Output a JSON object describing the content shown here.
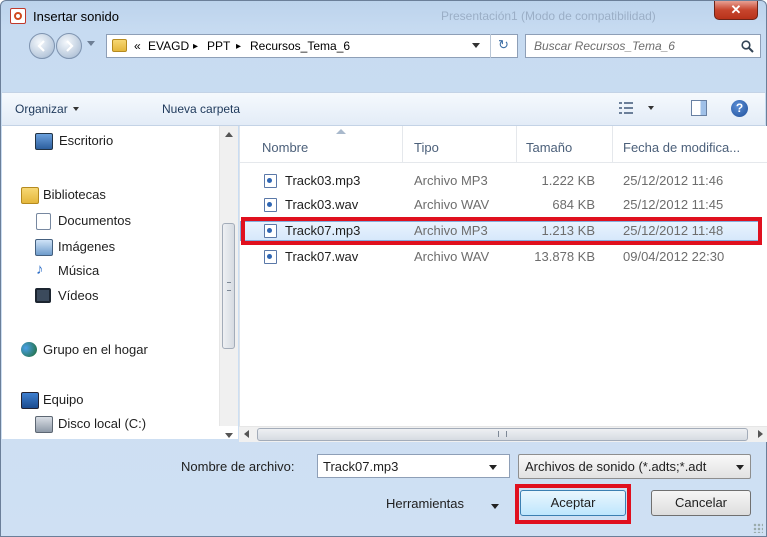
{
  "window": {
    "title": "Insertar sonido",
    "background_title": "Presentación1 (Modo de compatibilidad)"
  },
  "address": {
    "overflow": "«",
    "crumbs": [
      "EVAGD",
      "PPT",
      "Recursos_Tema_6"
    ],
    "separator": "▸",
    "search_placeholder": "Buscar Recursos_Tema_6"
  },
  "toolbar": {
    "organize": "Organizar",
    "new_folder": "Nueva carpeta"
  },
  "sidebar": {
    "items": [
      {
        "label": "Escritorio",
        "icon": "desktop-icon"
      },
      {
        "label": "Bibliotecas",
        "icon": "libraries-icon"
      },
      {
        "label": "Documentos",
        "icon": "documents-icon"
      },
      {
        "label": "Imágenes",
        "icon": "pictures-icon"
      },
      {
        "label": "Música",
        "icon": "music-icon"
      },
      {
        "label": "Vídeos",
        "icon": "videos-icon"
      },
      {
        "label": "Grupo en el hogar",
        "icon": "homegroup-icon"
      },
      {
        "label": "Equipo",
        "icon": "computer-icon"
      },
      {
        "label": "Disco local (C:)",
        "icon": "local-disk-icon"
      }
    ]
  },
  "files": {
    "columns": [
      "Nombre",
      "Tipo",
      "Tamaño",
      "Fecha de modifica..."
    ],
    "rows": [
      {
        "name": "Track03.mp3",
        "type": "Archivo MP3",
        "size": "1.222 KB",
        "date": "25/12/2012 11:46"
      },
      {
        "name": "Track03.wav",
        "type": "Archivo WAV",
        "size": "684 KB",
        "date": "25/12/2012 11:45"
      },
      {
        "name": "Track07.mp3",
        "type": "Archivo MP3",
        "size": "1.213 KB",
        "date": "25/12/2012 11:48"
      },
      {
        "name": "Track07.wav",
        "type": "Archivo WAV",
        "size": "13.878 KB",
        "date": "09/04/2012 22:30"
      }
    ],
    "selected_row": 2
  },
  "bottom": {
    "filename_label": "Nombre de archivo:",
    "filename_value": "Track07.mp3",
    "filetype": "Archivos de sonido (*.adts;*.adt",
    "tools": "Herramientas",
    "accept": "Aceptar",
    "cancel": "Cancelar"
  },
  "colors": {
    "highlight": "#e0101e",
    "selection": "#d6e8fb"
  }
}
